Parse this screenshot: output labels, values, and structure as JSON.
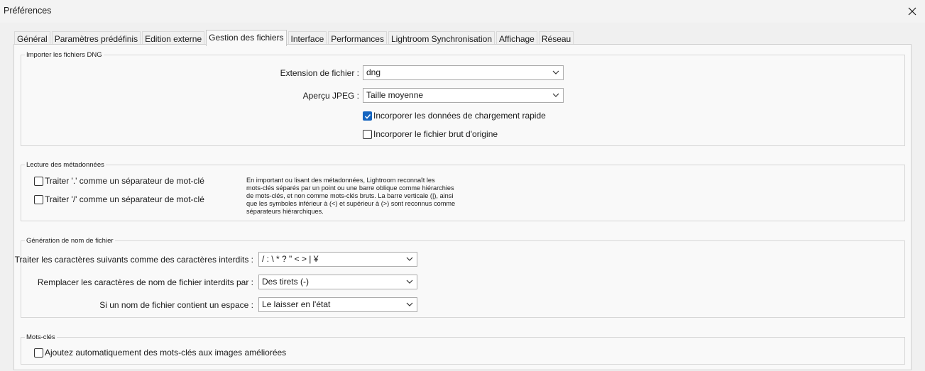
{
  "window": {
    "title": "Préférences"
  },
  "tabs": [
    {
      "label": "Général",
      "active": false
    },
    {
      "label": "Paramètres prédéfinis",
      "active": false
    },
    {
      "label": "Edition externe",
      "active": false
    },
    {
      "label": "Gestion des fichiers",
      "active": true
    },
    {
      "label": "Interface",
      "active": false
    },
    {
      "label": "Performances",
      "active": false
    },
    {
      "label": "Lightroom Synchronisation",
      "active": false
    },
    {
      "label": "Affichage",
      "active": false
    },
    {
      "label": "Réseau",
      "active": false
    }
  ],
  "dng": {
    "group_label": "Importer les fichiers DNG",
    "extension_label": "Extension de fichier :",
    "extension_value": "dng",
    "preview_label": "Aperçu JPEG :",
    "preview_value": "Taille moyenne",
    "fast_load_label": "Incorporer les données de chargement rapide",
    "fast_load_checked": true,
    "embed_raw_label": "Incorporer le fichier brut d'origine",
    "embed_raw_checked": false
  },
  "metadata": {
    "group_label": "Lecture des métadonnées",
    "dot_separator_label": "Traiter '.' comme un séparateur de mot-clé",
    "dot_separator_checked": false,
    "slash_separator_label": "Traiter '/' comme un séparateur de mot-clé",
    "slash_separator_checked": false,
    "description_lines": [
      "En important ou lisant des métadonnées, Lightroom reconnaît les",
      "mots-clés séparés par un point ou une barre oblique comme hiérarchies",
      "de mots-clés, et non comme mots-clés bruts. La barre verticale (|), ainsi",
      "que les symboles inférieur à (<) et supérieur à (>) sont reconnus comme",
      "séparateurs hiérarchiques."
    ]
  },
  "filename": {
    "group_label": "Génération de nom de fichier",
    "illegal_chars_label": "Traiter les caractères suivants comme des caractères interdits :",
    "illegal_chars_value": "/ : \\ * ? \" < > | ¥",
    "replace_label": "Remplacer les caractères de nom de fichier interdits par :",
    "replace_value": "Des tirets (-)",
    "space_label": "Si un nom de fichier contient un espace :",
    "space_value": "Le laisser en l'état"
  },
  "keywords": {
    "group_label": "Mots-clés",
    "auto_keywords_label": "Ajoutez automatiquement des mots-clés aux images améliorées",
    "auto_keywords_checked": false
  }
}
